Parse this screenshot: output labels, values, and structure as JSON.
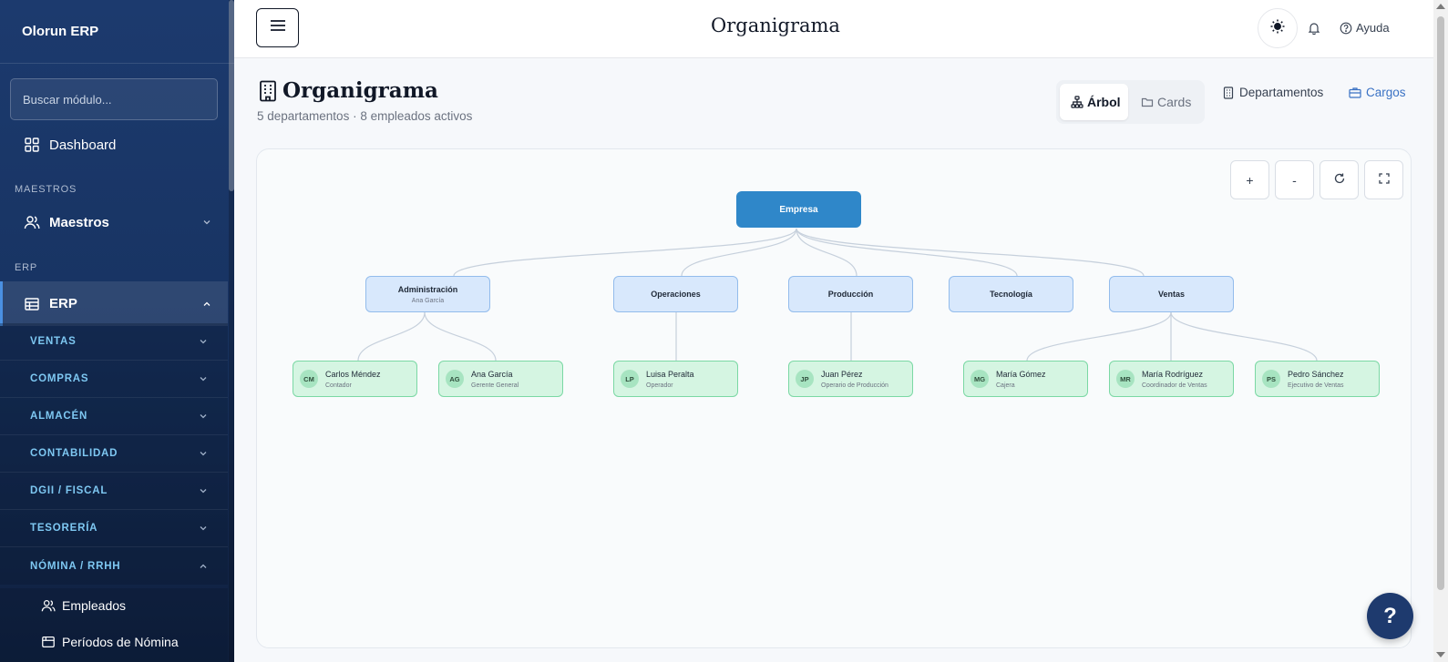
{
  "brand": "Olorun ERP",
  "search": {
    "placeholder": "Buscar módulo..."
  },
  "nav": {
    "dashboard": "Dashboard",
    "section_maestros": "MAESTROS",
    "maestros": "Maestros",
    "section_erp": "ERP",
    "erp": "ERP",
    "sub": [
      "VENTAS",
      "COMPRAS",
      "ALMACÉN",
      "CONTABILIDAD",
      "DGII / FISCAL",
      "TESORERÍA",
      "NÓMINA / RRHH"
    ],
    "leaf": [
      "Empleados",
      "Períodos de Nómina"
    ]
  },
  "header": {
    "title": "Organigrama",
    "help": "Ayuda"
  },
  "page": {
    "title": "Organigrama",
    "subtitle": "5 departamentos · 8 empleados activos",
    "view_tree": "Árbol",
    "view_cards": "Cards",
    "link_departments": "Departamentos",
    "link_positions": "Cargos"
  },
  "zoom": {
    "in": "+",
    "out": "-"
  },
  "org": {
    "root": "Empresa",
    "departments": [
      {
        "name": "Administración",
        "head": "Ana García"
      },
      {
        "name": "Operaciones",
        "head": ""
      },
      {
        "name": "Producción",
        "head": ""
      },
      {
        "name": "Tecnología",
        "head": ""
      },
      {
        "name": "Ventas",
        "head": ""
      }
    ],
    "employees": [
      {
        "initials": "CM",
        "name": "Carlos Méndez",
        "role": "Contador"
      },
      {
        "initials": "AG",
        "name": "Ana García",
        "role": "Gerente General"
      },
      {
        "initials": "LP",
        "name": "Luisa Peralta",
        "role": "Operador"
      },
      {
        "initials": "JP",
        "name": "Juan Pérez",
        "role": "Operario de Producción"
      },
      {
        "initials": "MG",
        "name": "María Gómez",
        "role": "Cajera"
      },
      {
        "initials": "MR",
        "name": "María Rodríguez",
        "role": "Coordinador de Ventas"
      },
      {
        "initials": "PS",
        "name": "Pedro Sánchez",
        "role": "Ejecutivo de Ventas"
      }
    ]
  },
  "fab": "?",
  "colors": {
    "sidebar": "#1c3a6e",
    "accent": "#2f87c9",
    "dept_bg": "#d8e8fc",
    "emp_bg": "#d5f5e2",
    "link": "#3a72c4"
  }
}
